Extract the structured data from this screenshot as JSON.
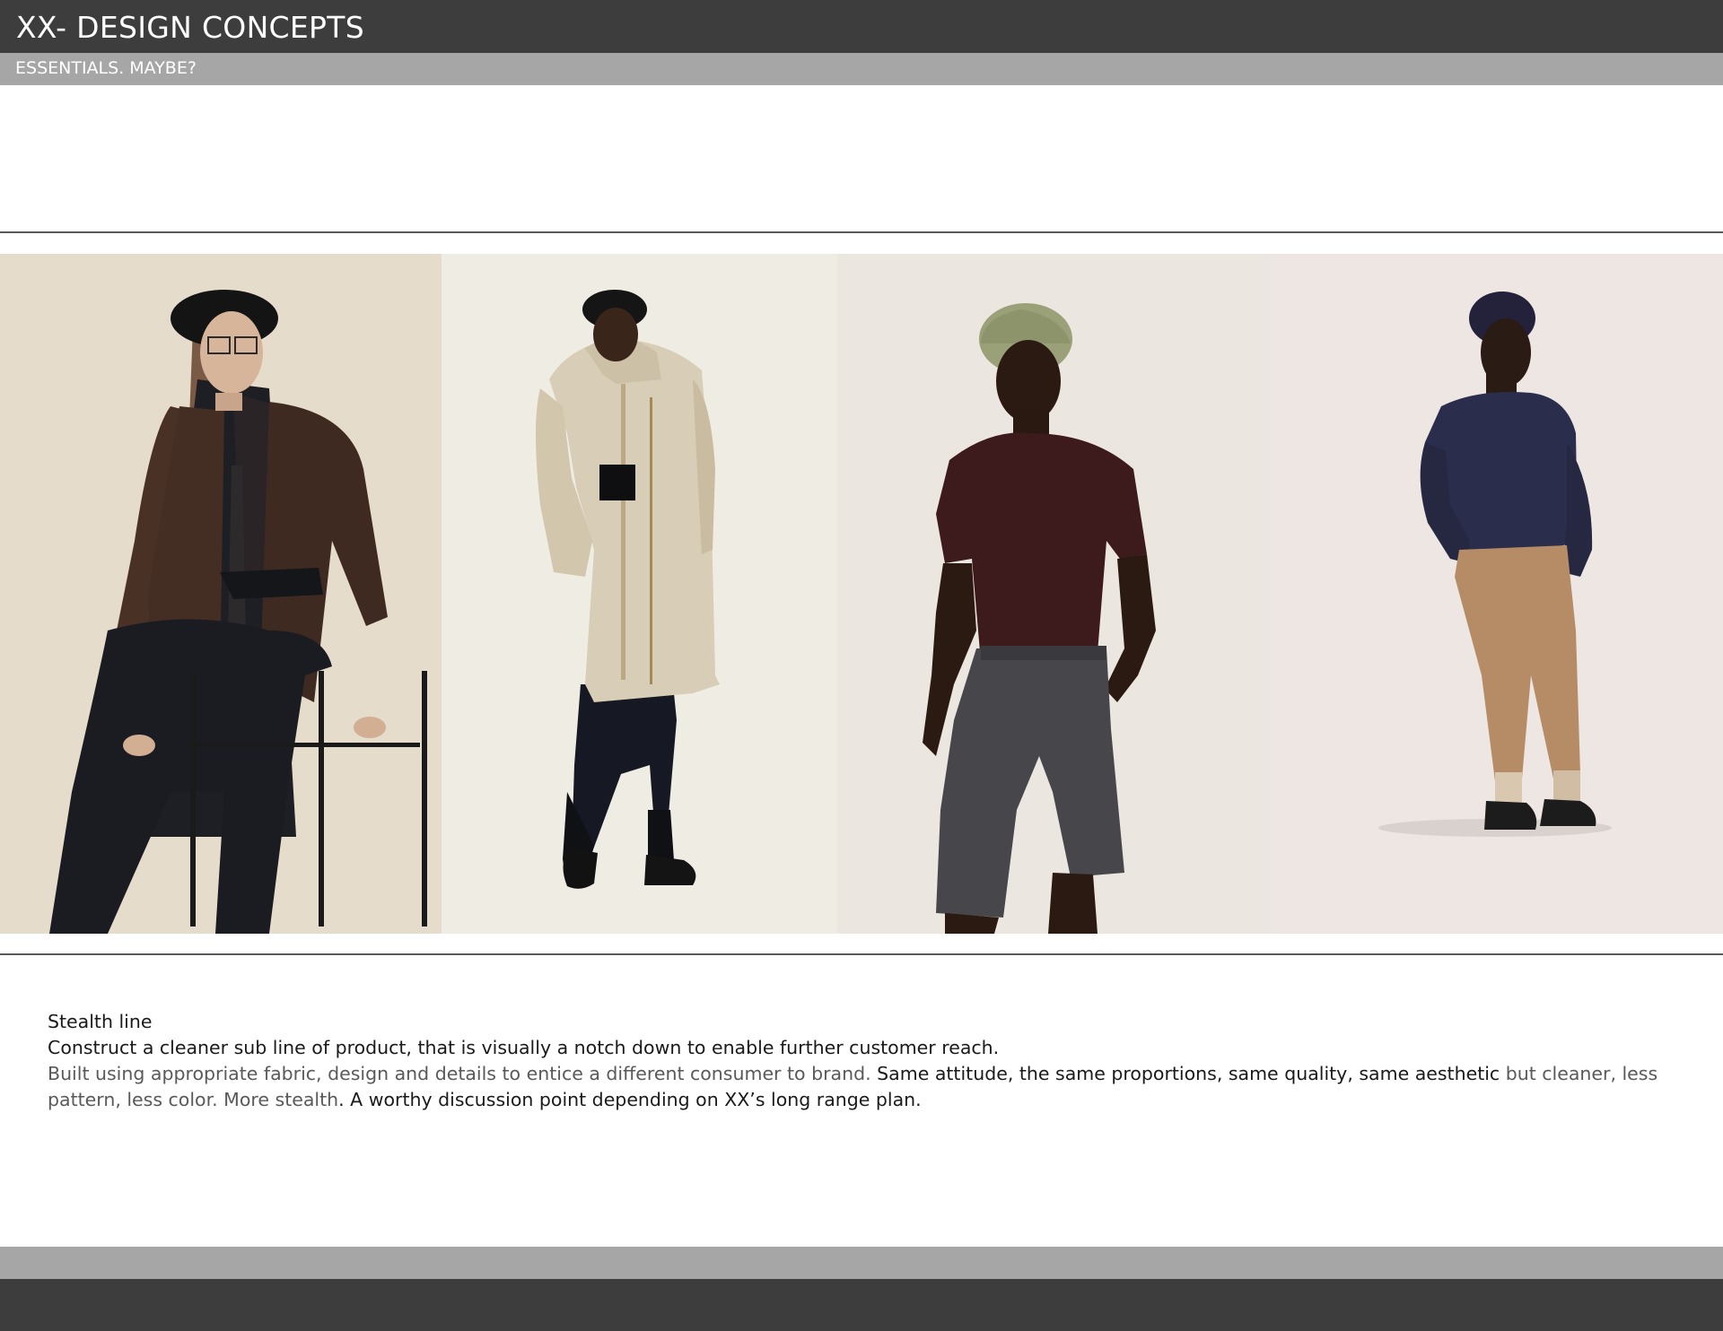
{
  "header": {
    "title": "XX- DESIGN CONCEPTS",
    "subtitle": "ESSENTIALS. MAYBE?"
  },
  "photos": [
    {
      "icon": "woman-in-beret-brown-blazer-seated-on-stool-image"
    },
    {
      "icon": "man-in-beret-stone-parka-cropped-trousers-image"
    },
    {
      "icon": "man-in-knit-beanie-burgundy-tee-grey-shorts-image"
    },
    {
      "icon": "man-in-navy-beanie-navy-sweater-camel-trousers-image"
    }
  ],
  "content": {
    "heading": "Stealth line",
    "line1": "Construct a cleaner sub line of product, that is visually a notch down to enable further customer reach.",
    "para_part1": "Built using appropriate fabric, design and details to entice a different consumer to brand. ",
    "para_part2": "Same attitude, the same proportions, same quality, same aesthetic",
    "para_part3": " but cleaner, less pattern, less color. More stealth",
    "para_part4": ". A worthy discussion point depending on XX’s long range plan."
  },
  "colors": {
    "header_dark": "#3d3d3d",
    "header_light": "#a6a6a6",
    "text_dark": "#1a1a1a",
    "text_grey": "#595959"
  }
}
